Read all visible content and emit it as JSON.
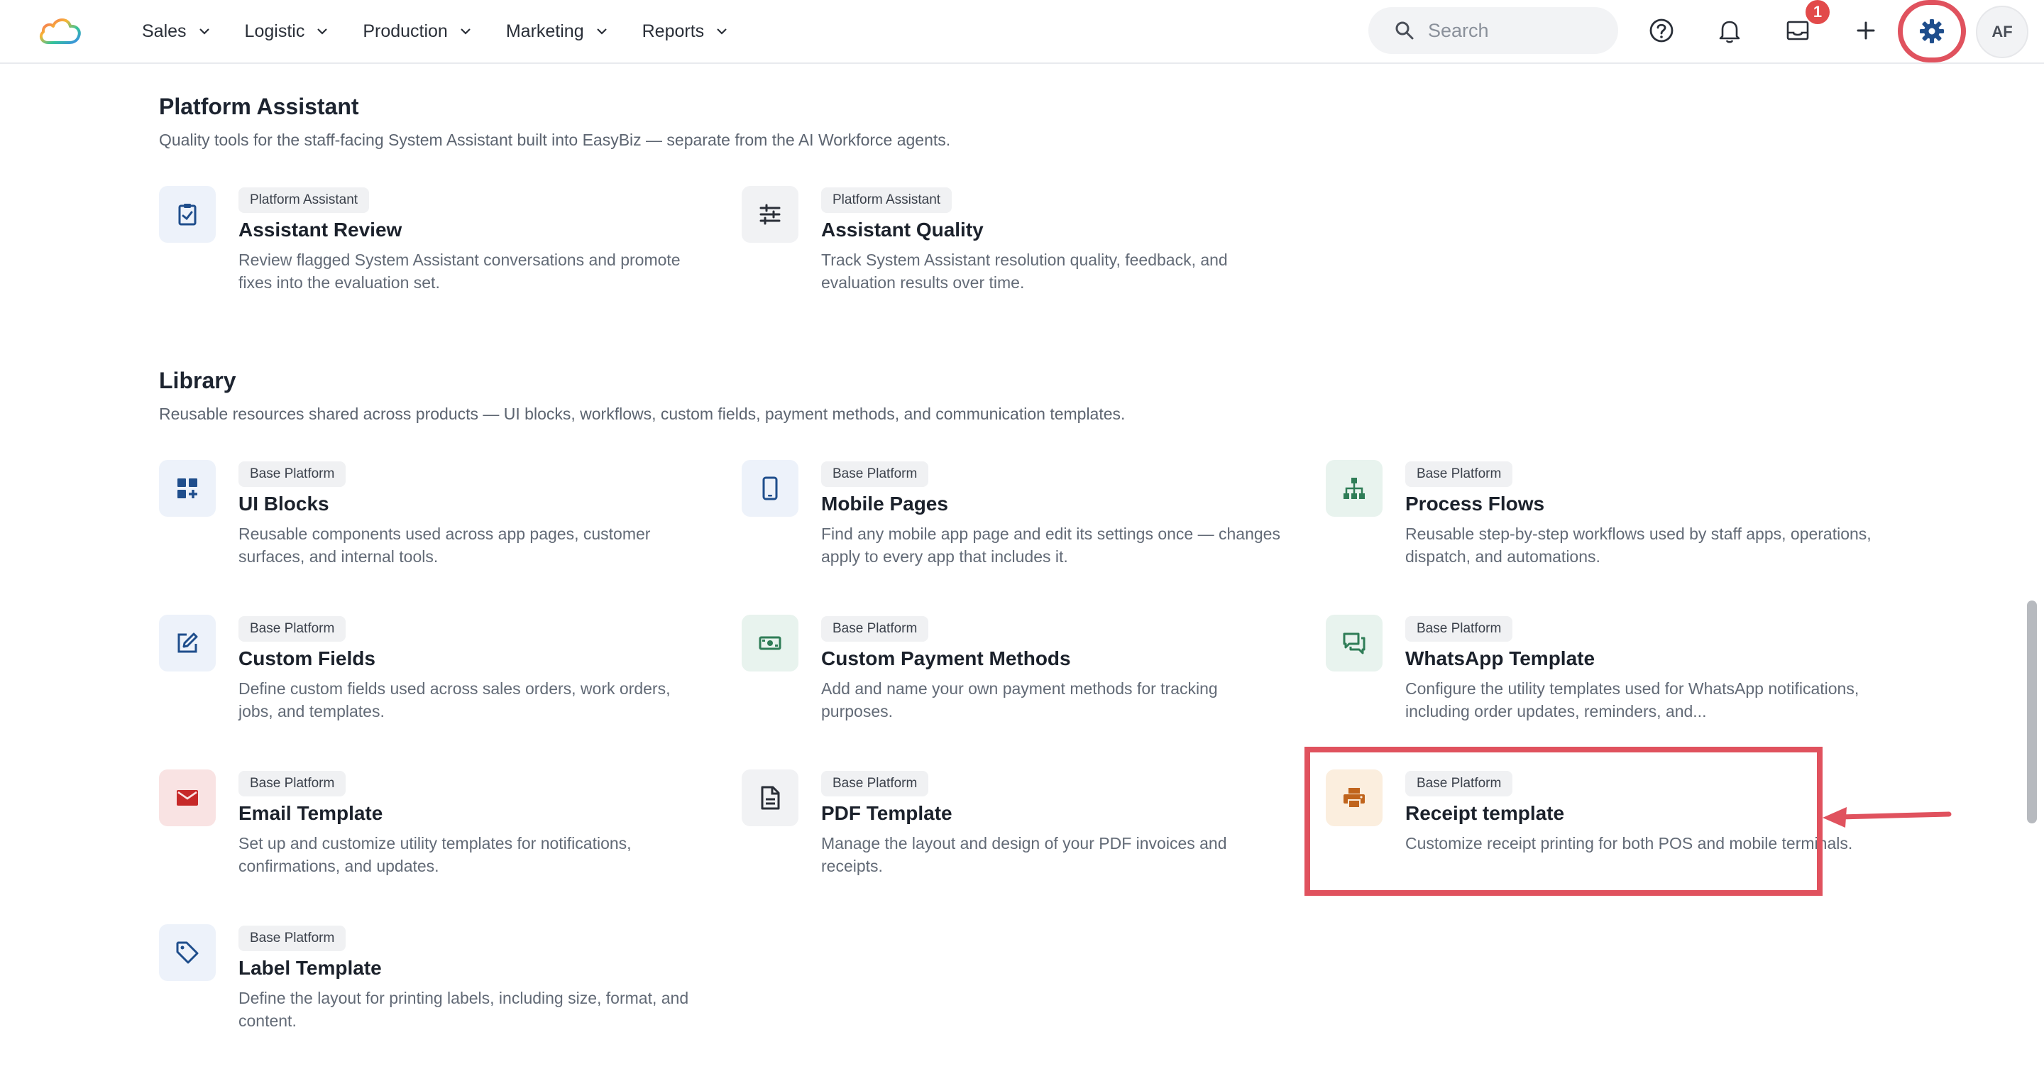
{
  "nav": {
    "items": [
      {
        "label": "Sales"
      },
      {
        "label": "Logistic"
      },
      {
        "label": "Production"
      },
      {
        "label": "Marketing"
      },
      {
        "label": "Reports"
      }
    ],
    "search_placeholder": "Search",
    "notification_count": "1",
    "avatar_initials": "AF"
  },
  "platform_assistant": {
    "title": "Platform Assistant",
    "description": "Quality tools for the staff-facing System Assistant built into EasyBiz — separate from the AI Workforce agents.",
    "cards": [
      {
        "tag": "Platform Assistant",
        "title": "Assistant Review",
        "description": "Review flagged System Assistant conversations and promote fixes into the evaluation set.",
        "icon": "clipboard-check-icon"
      },
      {
        "tag": "Platform Assistant",
        "title": "Assistant Quality",
        "description": "Track System Assistant resolution quality, feedback, and evaluation results over time.",
        "icon": "sliders-icon"
      }
    ]
  },
  "library": {
    "title": "Library",
    "description": "Reusable resources shared across products — UI blocks, workflows, custom fields, payment methods, and communication templates.",
    "cards": [
      {
        "tag": "Base Platform",
        "title": "UI Blocks",
        "description": "Reusable components used across app pages, customer surfaces, and internal tools.",
        "icon": "dashboard-add-icon"
      },
      {
        "tag": "Base Platform",
        "title": "Mobile Pages",
        "description": "Find any mobile app page and edit its settings once — changes apply to every app that includes it.",
        "icon": "mobile-icon"
      },
      {
        "tag": "Base Platform",
        "title": "Process Flows",
        "description": "Reusable step-by-step workflows used by staff apps, operations, dispatch, and automations.",
        "icon": "hierarchy-icon"
      },
      {
        "tag": "Base Platform",
        "title": "Custom Fields",
        "description": "Define custom fields used across sales orders, work orders, jobs, and templates.",
        "icon": "edit-square-icon"
      },
      {
        "tag": "Base Platform",
        "title": "Custom Payment Methods",
        "description": "Add and name your own payment methods for tracking purposes.",
        "icon": "banknote-icon"
      },
      {
        "tag": "Base Platform",
        "title": "WhatsApp Template",
        "description": "Configure the utility templates used for WhatsApp notifications, including order updates, reminders, and...",
        "icon": "chat-bubbles-icon"
      },
      {
        "tag": "Base Platform",
        "title": "Email Template",
        "description": "Set up and customize utility templates for notifications, confirmations, and updates.",
        "icon": "mail-icon"
      },
      {
        "tag": "Base Platform",
        "title": "PDF Template",
        "description": "Manage the layout and design of your PDF invoices and receipts.",
        "icon": "document-icon"
      },
      {
        "tag": "Base Platform",
        "title": "Receipt template",
        "description": "Customize receipt printing for both POS and mobile terminals.",
        "icon": "printer-icon"
      },
      {
        "tag": "Base Platform",
        "title": "Label Template",
        "description": "Define the layout for printing labels, including size, format, and content.",
        "icon": "tag-icon"
      }
    ]
  },
  "colors": {
    "accent_blue": "#1f4e8c",
    "annotation_red": "#e0525e",
    "email_red": "#c62828",
    "printer_orange": "#c0641c",
    "green_icon": "#2f7d57"
  }
}
